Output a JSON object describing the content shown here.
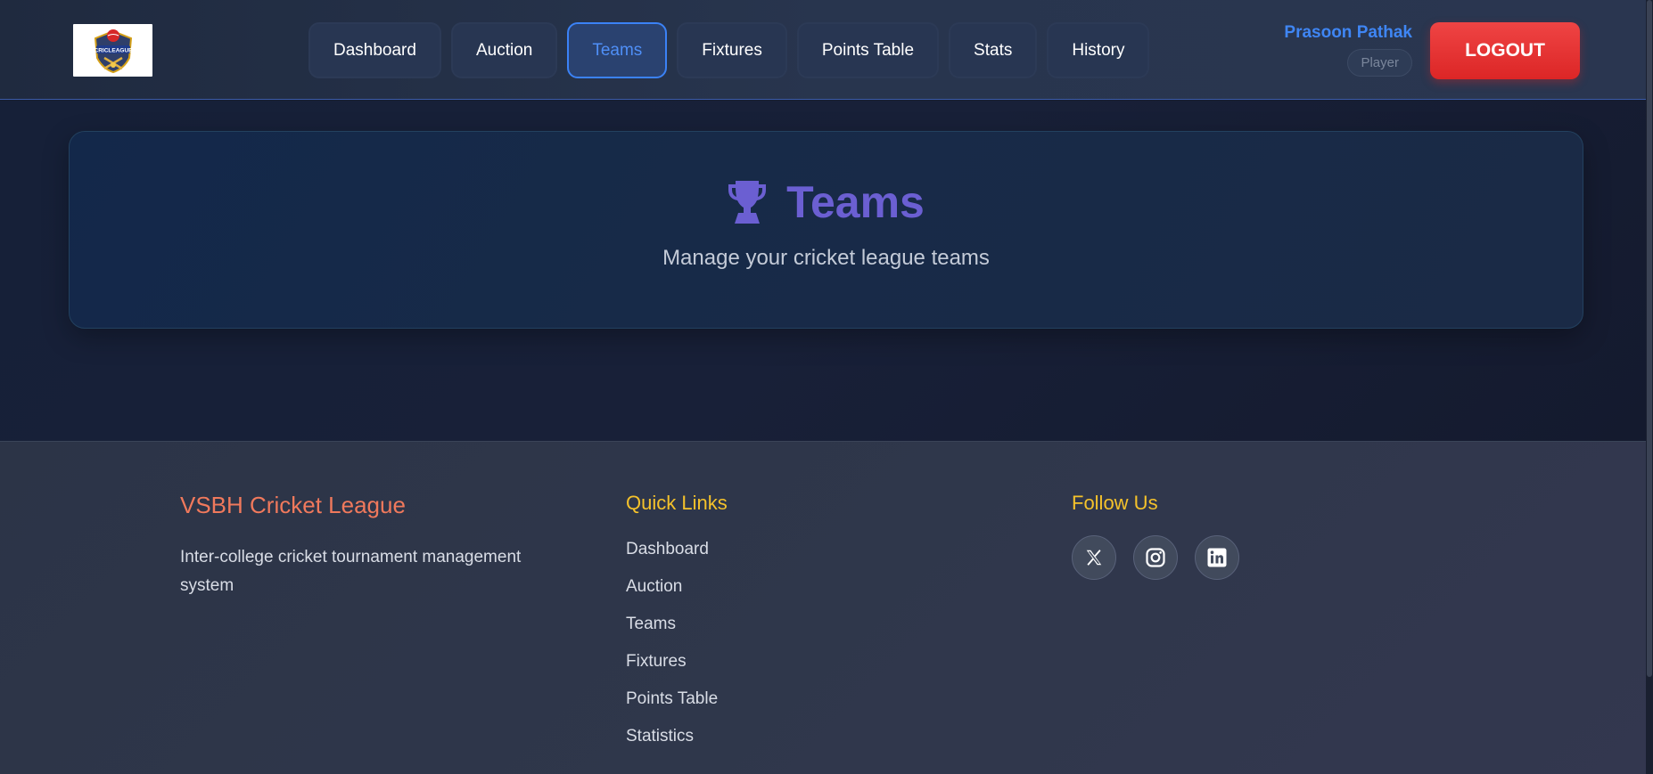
{
  "nav": {
    "logo_text": "CRICLEAGUE",
    "links": [
      "Dashboard",
      "Auction",
      "Teams",
      "Fixtures",
      "Points Table",
      "Stats",
      "History"
    ],
    "active": "Teams"
  },
  "user": {
    "name": "Prasoon Pathak",
    "role": "Player",
    "logout_label": "LOGOUT"
  },
  "hero": {
    "icon": "trophy-icon",
    "title": "Teams",
    "subtitle": "Manage your cricket league teams"
  },
  "footer": {
    "brand": "VSBH Cricket League",
    "description": "Inter-college cricket tournament management system",
    "quick_links_title": "Quick Links",
    "quick_links": [
      "Dashboard",
      "Auction",
      "Teams",
      "Fixtures",
      "Points Table",
      "Statistics"
    ],
    "follow_title": "Follow Us",
    "socials": [
      "x-icon",
      "instagram-icon",
      "linkedin-icon"
    ]
  },
  "colors": {
    "accent": "#3b82f6",
    "hero_title": "#6b5fd2",
    "logout": "#dc2626",
    "footer_brand": "#f0795c",
    "footer_heading": "#f5c22b"
  }
}
